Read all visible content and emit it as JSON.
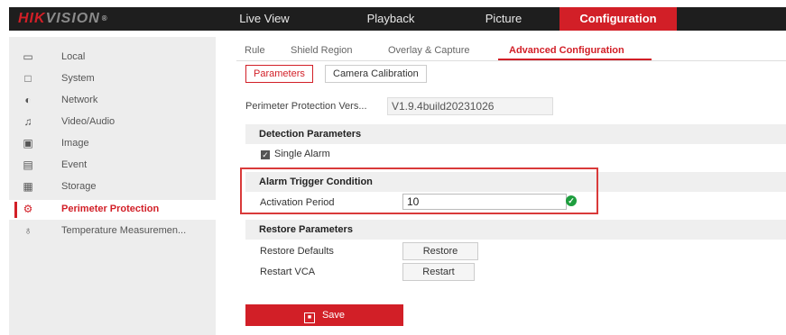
{
  "brand": {
    "logo_main": "HIK",
    "logo_sub": "VISION",
    "reg": "®"
  },
  "topnav": [
    {
      "label": "Live View"
    },
    {
      "label": "Playback"
    },
    {
      "label": "Picture"
    },
    {
      "label": "Configuration",
      "active": true
    }
  ],
  "sidebar": {
    "items": [
      {
        "label": "Local",
        "icon": "monitor-icon"
      },
      {
        "label": "System",
        "icon": "system-icon"
      },
      {
        "label": "Network",
        "icon": "network-icon"
      },
      {
        "label": "Video/Audio",
        "icon": "video-audio-icon"
      },
      {
        "label": "Image",
        "icon": "image-icon"
      },
      {
        "label": "Event",
        "icon": "event-icon"
      },
      {
        "label": "Storage",
        "icon": "storage-icon"
      },
      {
        "label": "Perimeter Protection",
        "icon": "perimeter-icon",
        "active": true
      },
      {
        "label": "Temperature Measuremen...",
        "icon": "thermometer-icon"
      }
    ]
  },
  "tabs": [
    {
      "label": "Rule"
    },
    {
      "label": "Shield Region"
    },
    {
      "label": "Overlay & Capture"
    },
    {
      "label": "Advanced Configuration",
      "active": true
    }
  ],
  "subtabs": [
    {
      "label": "Parameters",
      "active": true
    },
    {
      "label": "Camera Calibration"
    }
  ],
  "version": {
    "label": "Perimeter Protection Vers...",
    "value": "V1.9.4build20231026"
  },
  "detection": {
    "title": "Detection Parameters",
    "single_alarm": "Single Alarm",
    "checked": true
  },
  "alarm_trigger": {
    "title": "Alarm Trigger Condition",
    "activation_label": "Activation Period",
    "activation_value": "10"
  },
  "restore": {
    "title": "Restore Parameters",
    "defaults_label": "Restore Defaults",
    "restore_button": "Restore",
    "restart_label": "Restart VCA",
    "restart_button": "Restart"
  },
  "save_label": "Save",
  "colors": {
    "accent": "#d21f27",
    "topbar": "#1e1e1e",
    "success": "#1e9e3e",
    "highlight": "#d93a3a"
  }
}
